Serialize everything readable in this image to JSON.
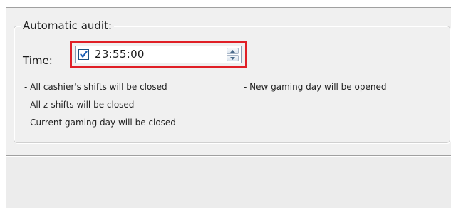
{
  "audit_group": {
    "title": "Automatic audit:",
    "time_label": "Time:",
    "time_enabled": true,
    "time_value": "23:55:00",
    "notes_left": [
      "- All cashier's shifts will be closed",
      "- All z-shifts will be closed",
      "- Current gaming day will be closed"
    ],
    "notes_right": [
      "- New gaming day will be opened"
    ]
  },
  "colors": {
    "highlight_border": "#e01f26",
    "checkmark": "#1c5fb5",
    "window_bg": "#f0f0f0"
  },
  "icons": {
    "checkbox": "check-icon",
    "spin_up": "spin-up-arrow-icon",
    "spin_down": "spin-down-arrow-icon"
  }
}
